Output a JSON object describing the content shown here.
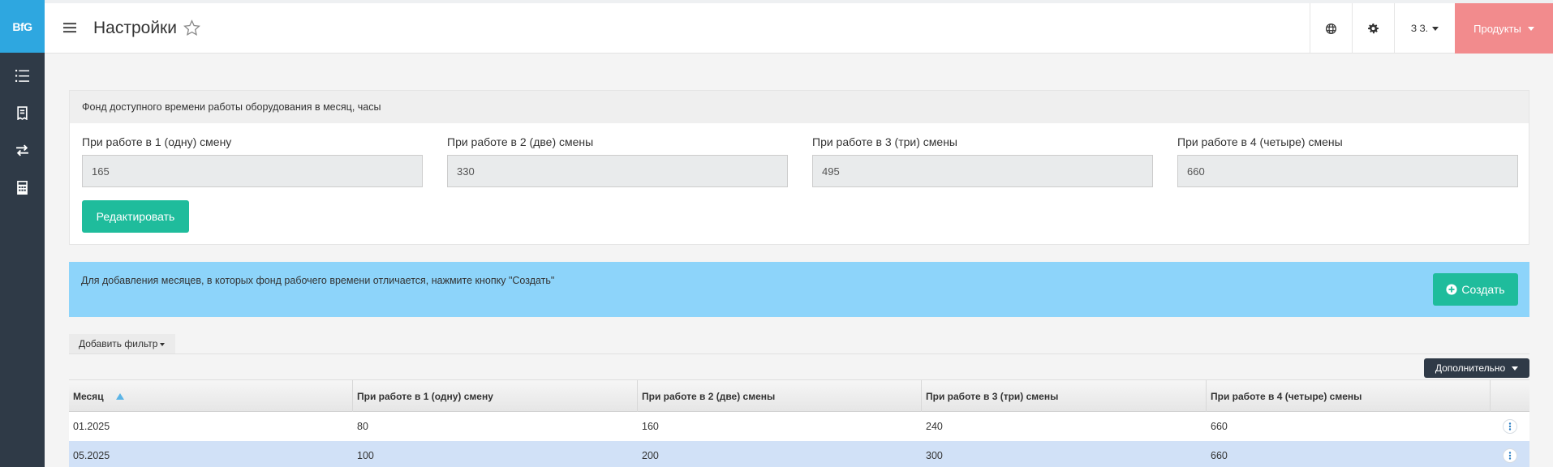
{
  "app": {
    "logo": "BfG"
  },
  "header": {
    "title": "Настройки",
    "user_label": "З З.",
    "products_label": "Продукты"
  },
  "sidebar": {
    "items": [
      {
        "icon": "list-icon"
      },
      {
        "icon": "receipt-icon"
      },
      {
        "icon": "exchange-icon"
      },
      {
        "icon": "calculator-icon"
      }
    ]
  },
  "panel": {
    "title": "Фонд доступного времени работы оборудования в месяц, часы",
    "fields": [
      {
        "label": "При работе в 1 (одну) смену",
        "value": "165"
      },
      {
        "label": "При работе в 2 (две) смены",
        "value": "330"
      },
      {
        "label": "При работе в 3 (три) смены",
        "value": "495"
      },
      {
        "label": "При работе в 4 (четыре) смены",
        "value": "660"
      }
    ],
    "edit_label": "Редактировать"
  },
  "info": {
    "text": "Для добавления месяцев, в которых фонд рабочего времени отличается, нажмите кнопку \"Создать\"",
    "create_label": "Создать"
  },
  "filter": {
    "add_label": "Добавить фильтр"
  },
  "extra": {
    "label": "Дополнительно"
  },
  "table": {
    "headers": [
      "Месяц",
      "При работе в 1 (одну) смену",
      "При работе в 2 (две) смены",
      "При работе в 3 (три) смены",
      "При работе в 4 (четыре) смены"
    ],
    "rows": [
      {
        "month": "01.2025",
        "s1": "80",
        "s2": "160",
        "s3": "240",
        "s4": "660"
      },
      {
        "month": "05.2025",
        "s1": "100",
        "s2": "200",
        "s3": "300",
        "s4": "660"
      }
    ]
  },
  "colors": {
    "accent": "#2ea7e0",
    "green": "#1fbc9c",
    "products": "#f28b8d",
    "sidebar": "#2f3a47",
    "info": "#8dd4fa"
  }
}
